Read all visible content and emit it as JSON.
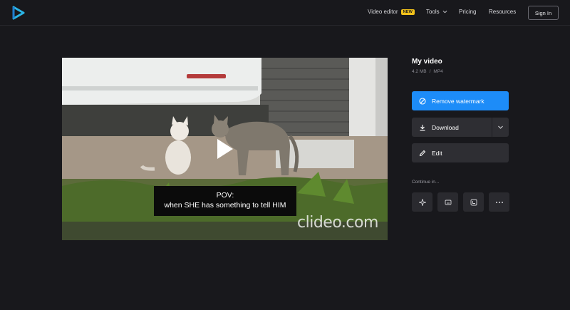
{
  "header": {
    "nav": {
      "video_editor": "Video editor",
      "new_badge": "NEW",
      "tools": "Tools",
      "pricing": "Pricing",
      "resources": "Resources"
    },
    "signin_label": "Sign In"
  },
  "video": {
    "caption_line1": "POV:",
    "caption_line2": "when SHE has something to tell HIM",
    "watermark": "clideo.com"
  },
  "panel": {
    "title": "My video",
    "size": "4.2 MB",
    "separator": "/",
    "format": "MP4",
    "remove_watermark_label": "Remove watermark",
    "download_label": "Download",
    "edit_label": "Edit",
    "continue_label": "Continue in..."
  },
  "icons": [
    "logo-icon",
    "chevron-down-icon",
    "play-icon",
    "no-watermark-icon",
    "download-icon",
    "pencil-icon",
    "sparkle-icon",
    "subtitles-icon",
    "crop-icon",
    "more-dots-icon"
  ],
  "colors": {
    "accent": "#1d8cf8",
    "badge": "#f2c21b",
    "logo": "#2bb5e6",
    "background": "#18181c"
  }
}
